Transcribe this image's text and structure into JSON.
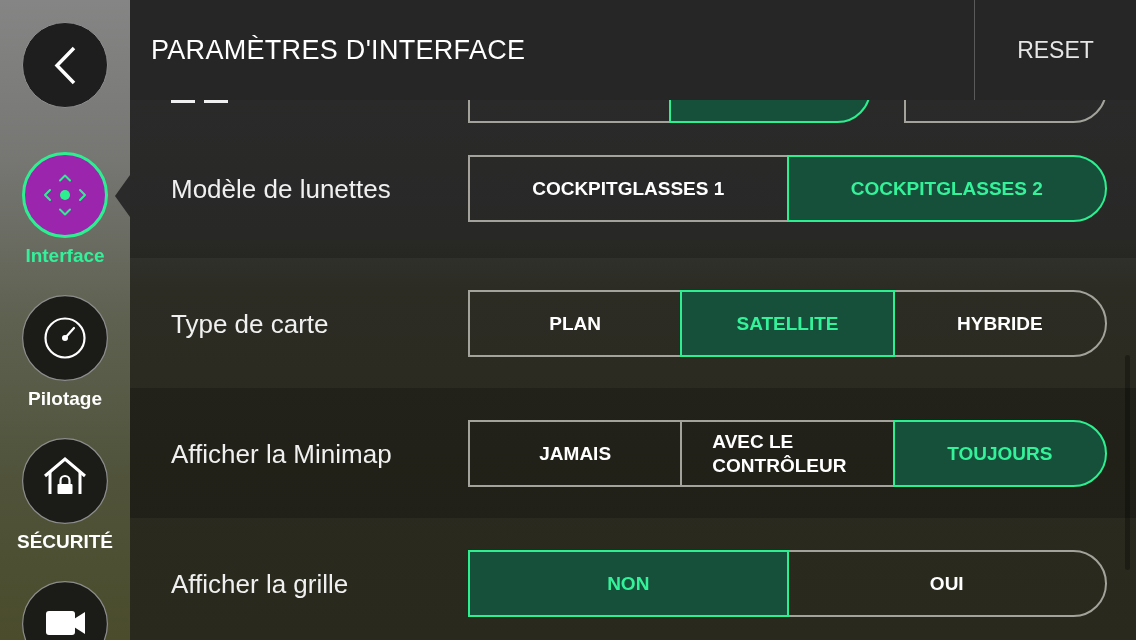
{
  "header": {
    "title": "PARAMÈTRES D'INTERFACE",
    "reset": "RESET"
  },
  "sidebar": {
    "items": [
      {
        "kind": "back",
        "selected": false
      },
      {
        "kind": "interface",
        "label": "Interface",
        "selected": true
      },
      {
        "kind": "piloting",
        "label": "Pilotage",
        "selected": false
      },
      {
        "kind": "security",
        "label": "SÉCURITÉ",
        "selected": false
      },
      {
        "kind": "camera",
        "selected": false
      }
    ]
  },
  "settings": [
    {
      "kind": "scrolled_off",
      "controls": [
        {
          "options": [
            {
              "selected": false
            },
            {
              "selected": true
            }
          ]
        },
        {
          "options": [
            {
              "selected": false
            }
          ]
        }
      ]
    },
    {
      "kind": "setting",
      "label": "Modèle de lunettes",
      "controls": [
        {
          "options": [
            {
              "label": "COCKPITGLASSES 1",
              "selected": false
            },
            {
              "label": "COCKPITGLASSES 2",
              "selected": true
            }
          ]
        }
      ]
    },
    {
      "kind": "setting",
      "label": "Type de carte",
      "controls": [
        {
          "options": [
            {
              "label": "PLAN",
              "selected": false
            },
            {
              "label": "SATELLITE",
              "selected": true
            },
            {
              "label": "HYBRIDE",
              "selected": false
            }
          ]
        }
      ]
    },
    {
      "kind": "setting",
      "label": "Afficher la Minimap",
      "controls": [
        {
          "options": [
            {
              "label": "JAMAIS",
              "selected": false
            },
            {
              "label": "AVEC LE CONTRÔLEUR",
              "selected": false
            },
            {
              "label": "TOUJOURS",
              "selected": true
            }
          ]
        }
      ]
    },
    {
      "kind": "setting",
      "label": "Afficher la grille",
      "controls": [
        {
          "options": [
            {
              "label": "NON",
              "selected": true
            },
            {
              "label": "OUI",
              "selected": false
            }
          ]
        }
      ]
    }
  ]
}
